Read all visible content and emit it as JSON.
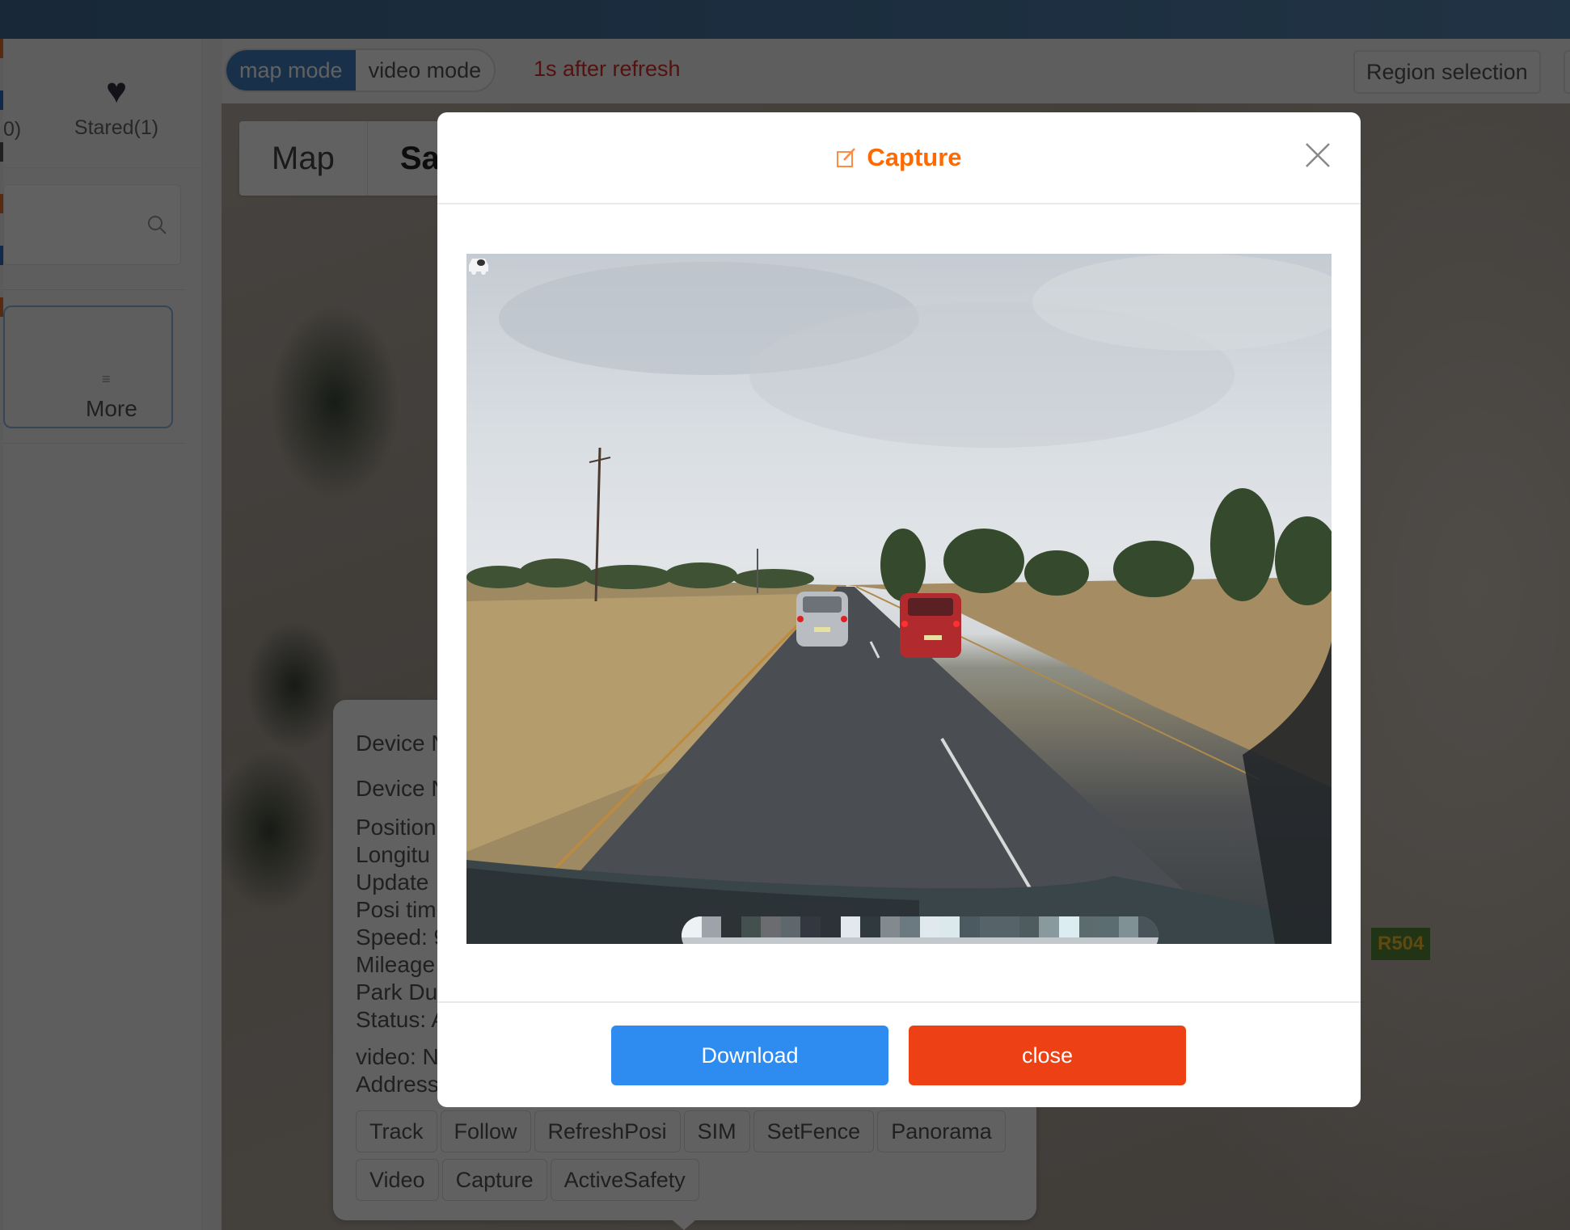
{
  "app": {
    "sidebar": {
      "tab_all_count_fragment": "0)",
      "tab_stared_label": "Stared(1)",
      "search_placeholder": "",
      "more_label": "More"
    },
    "toolbar": {
      "modes": [
        {
          "label": "map mode",
          "active": true
        },
        {
          "label": "video mode",
          "active": false
        }
      ],
      "refresh_note": "1s after refresh",
      "region_selection_label": "Region selection"
    },
    "map": {
      "tabs": [
        {
          "label": "Map",
          "active": false
        },
        {
          "label": "Sa",
          "active": true
        }
      ],
      "road_label": "R504"
    },
    "device_info": {
      "lines": [
        "Device N",
        "Device N",
        "Position",
        "Longitu",
        "Update",
        "Posi tim",
        "Speed: 9",
        "Mileage",
        "Park Du",
        "Status: A",
        "video: N",
        "Address"
      ],
      "actions_row1": [
        "Track",
        "Follow",
        "RefreshPosi",
        "SIM",
        "SetFence",
        "Panorama"
      ],
      "actions_row2": [
        "Video",
        "Capture",
        "ActiveSafety"
      ]
    }
  },
  "modal": {
    "title": "Capture",
    "title_icon": "edit-icon",
    "title_color": "#ff6a00",
    "image_alt": "Dashcam capture: rural two-lane road with a silver and a red hatchback ahead under an overcast sky",
    "buttons": {
      "download_label": "Download",
      "close_label": "close"
    },
    "colors": {
      "download": "#2e8cf0",
      "close": "#ed4014"
    }
  }
}
